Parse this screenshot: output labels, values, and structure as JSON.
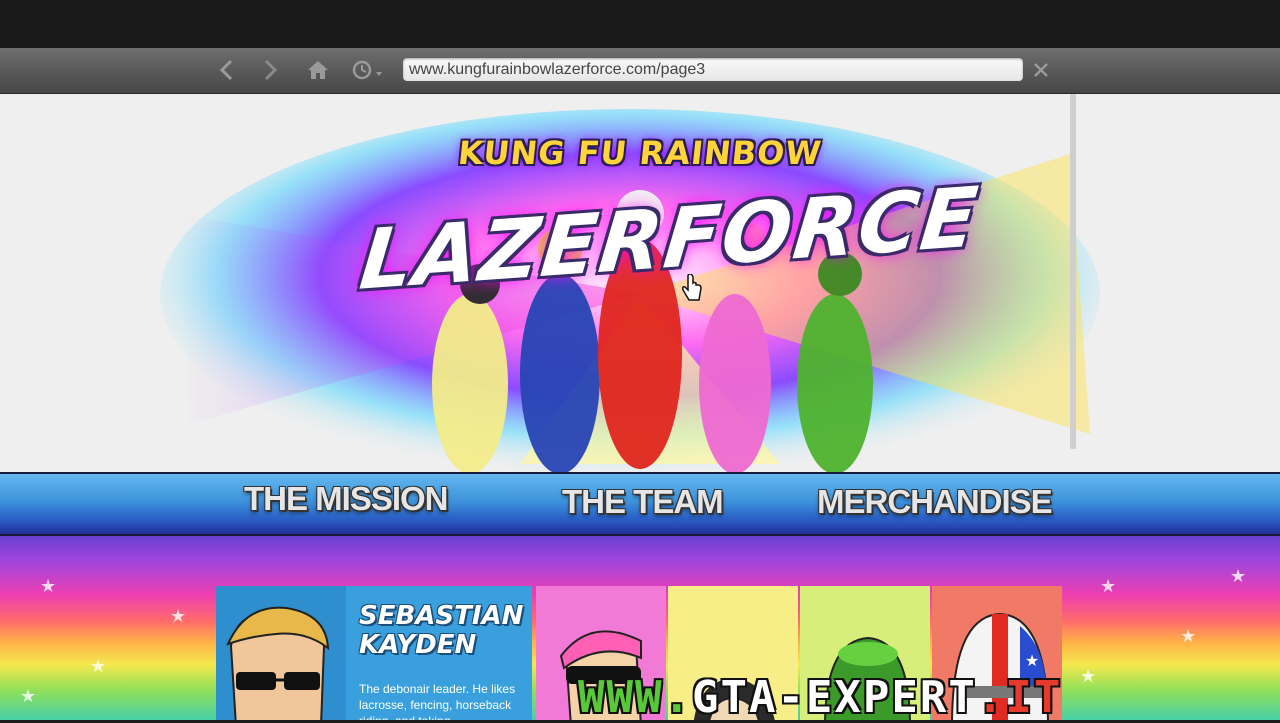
{
  "browser": {
    "url": "www.kungfurainbowlazerforce.com/page3",
    "buttons": [
      "back-icon",
      "forward-icon",
      "home-icon",
      "history-icon",
      "close-icon"
    ]
  },
  "hero": {
    "logo_line1": "KUNG FU RAINBOW",
    "logo_line2": "LAZERFORCE"
  },
  "nav": {
    "items": [
      "THE MISSION",
      "THE TEAM",
      "MERCHANDISE"
    ]
  },
  "team": {
    "featured": {
      "name_line1": "SEBASTIAN",
      "name_line2": "KAYDEN",
      "description": "The debonair leader. He likes lacrosse, fencing, horseback riding, and taking"
    },
    "other_cards": [
      {
        "color": "#f07ad6"
      },
      {
        "color": "#f7ee88"
      },
      {
        "color": "#d7ef7a"
      },
      {
        "color": "#f07a66"
      }
    ]
  },
  "watermark": {
    "part1": "WWW.",
    "part2": "GTA-EXPERT",
    "part3": ".IT"
  }
}
